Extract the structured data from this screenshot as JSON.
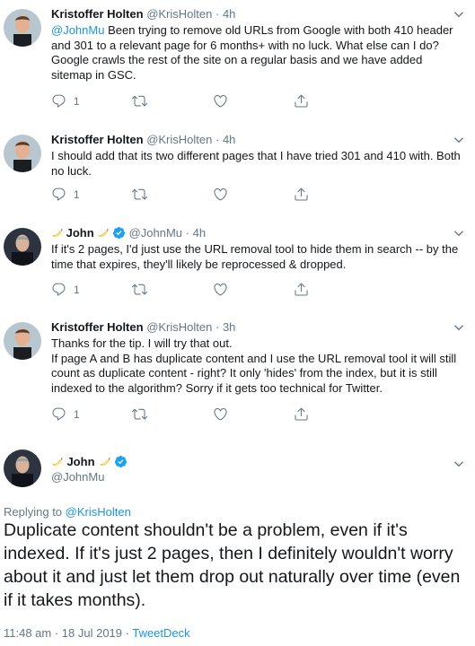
{
  "tweets": [
    {
      "name": "Kristoffer Holten",
      "handle": "@KrisHolten",
      "separator": "·",
      "time": "4h",
      "mention": "@JohnMu",
      "text": " Been trying to remove old URLs from Google with both 410 header and 301 to a relevant page for 6 months+ with no luck. What else can I do? Google crawls the rest of the site on a regular basis and we have added sitemap in GSC.",
      "reply_count": "1"
    },
    {
      "name": "Kristoffer Holten",
      "handle": "@KrisHolten",
      "separator": "·",
      "time": "4h",
      "text": "I should add that its two different pages that I have tried 301 and 410 with. Both no luck.",
      "reply_count": "1"
    },
    {
      "name": "John",
      "handle": "@JohnMu",
      "separator": "·",
      "time": "4h",
      "text": "If it's 2 pages, I'd just use the URL removal tool to hide them in search -- by the time that expires, they'll likely be reprocessed & dropped.",
      "reply_count": "1"
    },
    {
      "name": "Kristoffer Holten",
      "handle": "@KrisHolten",
      "separator": "·",
      "time": "3h",
      "line1": "Thanks for the tip. I will try that out.",
      "line2": "If page A and B has duplicate content and I use the URL removal tool it will still count as duplicate content - right? It only 'hides' from the index, but it is still indexed to the algorithm? Sorry if it gets too technical for Twitter.",
      "reply_count": "1"
    }
  ],
  "main": {
    "name": "John",
    "handle": "@JohnMu",
    "replying_prefix": "Replying to ",
    "replying_to": "@KrisHolten",
    "text": "Duplicate content shouldn't be a problem, even if it's indexed. If it's just 2 pages, then I definitely wouldn't worry about it and just let them drop out naturally over time (even if it takes months).",
    "timestamp": "11:48 am · 18 Jul 2019 · ",
    "source": "TweetDeck"
  },
  "icons": {
    "reply": "reply-icon",
    "retweet": "retweet-icon",
    "like": "heart-icon",
    "share": "share-icon",
    "verified": "verified-badge-icon",
    "emoji": "banana-emoji-icon",
    "caret": "chevron-down-icon"
  },
  "colors": {
    "link": "#1b95e0",
    "muted": "#657786",
    "text": "#14171a",
    "verified": "#1da1f2",
    "banana": "#ffd43b"
  }
}
